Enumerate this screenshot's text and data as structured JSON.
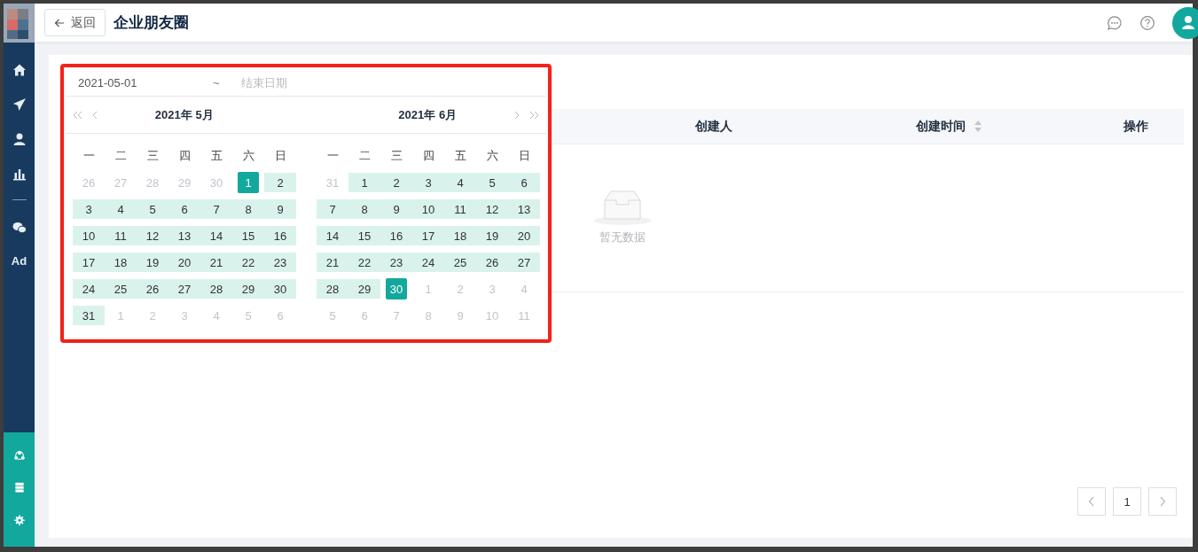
{
  "sidebar": {
    "top_items": [
      {
        "kind": "home"
      },
      {
        "kind": "send"
      },
      {
        "kind": "user"
      },
      {
        "kind": "chart"
      },
      {
        "kind": "divider"
      },
      {
        "kind": "wechat"
      },
      {
        "kind": "text",
        "label": "Ad"
      }
    ],
    "bottom_items": [
      {
        "kind": "network"
      },
      {
        "kind": "server"
      },
      {
        "kind": "settings"
      }
    ]
  },
  "header": {
    "back_button": "返回",
    "title": "企业朋友圈"
  },
  "date_picker": {
    "start_value": "2021-05-01",
    "separator": "~",
    "end_placeholder": "结束日期",
    "panels": [
      {
        "title": "2021年 5月",
        "weekdays": [
          "一",
          "二",
          "三",
          "四",
          "五",
          "六",
          "日"
        ],
        "weeks": [
          [
            {
              "d": "26",
              "kind": "out"
            },
            {
              "d": "27",
              "kind": "out"
            },
            {
              "d": "28",
              "kind": "out"
            },
            {
              "d": "29",
              "kind": "out"
            },
            {
              "d": "30",
              "kind": "out"
            },
            {
              "d": "1",
              "kind": "endpoint"
            },
            {
              "d": "2",
              "kind": "range"
            }
          ],
          [
            {
              "d": "3",
              "kind": "range"
            },
            {
              "d": "4",
              "kind": "range"
            },
            {
              "d": "5",
              "kind": "range"
            },
            {
              "d": "6",
              "kind": "range"
            },
            {
              "d": "7",
              "kind": "range"
            },
            {
              "d": "8",
              "kind": "range"
            },
            {
              "d": "9",
              "kind": "range"
            }
          ],
          [
            {
              "d": "10",
              "kind": "range"
            },
            {
              "d": "11",
              "kind": "range"
            },
            {
              "d": "12",
              "kind": "range"
            },
            {
              "d": "13",
              "kind": "range"
            },
            {
              "d": "14",
              "kind": "range"
            },
            {
              "d": "15",
              "kind": "range"
            },
            {
              "d": "16",
              "kind": "range"
            }
          ],
          [
            {
              "d": "17",
              "kind": "range"
            },
            {
              "d": "18",
              "kind": "range"
            },
            {
              "d": "19",
              "kind": "range"
            },
            {
              "d": "20",
              "kind": "range"
            },
            {
              "d": "21",
              "kind": "range"
            },
            {
              "d": "22",
              "kind": "range"
            },
            {
              "d": "23",
              "kind": "range"
            }
          ],
          [
            {
              "d": "24",
              "kind": "range"
            },
            {
              "d": "25",
              "kind": "range"
            },
            {
              "d": "26",
              "kind": "range"
            },
            {
              "d": "27",
              "kind": "range"
            },
            {
              "d": "28",
              "kind": "range"
            },
            {
              "d": "29",
              "kind": "range"
            },
            {
              "d": "30",
              "kind": "range"
            }
          ],
          [
            {
              "d": "31",
              "kind": "range"
            },
            {
              "d": "1",
              "kind": "out"
            },
            {
              "d": "2",
              "kind": "out"
            },
            {
              "d": "3",
              "kind": "out"
            },
            {
              "d": "4",
              "kind": "out"
            },
            {
              "d": "5",
              "kind": "out"
            },
            {
              "d": "6",
              "kind": "out"
            }
          ]
        ]
      },
      {
        "title": "2021年 6月",
        "weekdays": [
          "一",
          "二",
          "三",
          "四",
          "五",
          "六",
          "日"
        ],
        "weeks": [
          [
            {
              "d": "31",
              "kind": "out"
            },
            {
              "d": "1",
              "kind": "range"
            },
            {
              "d": "2",
              "kind": "range"
            },
            {
              "d": "3",
              "kind": "range"
            },
            {
              "d": "4",
              "kind": "range"
            },
            {
              "d": "5",
              "kind": "range"
            },
            {
              "d": "6",
              "kind": "range"
            }
          ],
          [
            {
              "d": "7",
              "kind": "range"
            },
            {
              "d": "8",
              "kind": "range"
            },
            {
              "d": "9",
              "kind": "range"
            },
            {
              "d": "10",
              "kind": "range"
            },
            {
              "d": "11",
              "kind": "range"
            },
            {
              "d": "12",
              "kind": "range"
            },
            {
              "d": "13",
              "kind": "range"
            }
          ],
          [
            {
              "d": "14",
              "kind": "range"
            },
            {
              "d": "15",
              "kind": "range"
            },
            {
              "d": "16",
              "kind": "range"
            },
            {
              "d": "17",
              "kind": "range"
            },
            {
              "d": "18",
              "kind": "range"
            },
            {
              "d": "19",
              "kind": "range"
            },
            {
              "d": "20",
              "kind": "range"
            }
          ],
          [
            {
              "d": "21",
              "kind": "range"
            },
            {
              "d": "22",
              "kind": "range"
            },
            {
              "d": "23",
              "kind": "range"
            },
            {
              "d": "24",
              "kind": "range"
            },
            {
              "d": "25",
              "kind": "range"
            },
            {
              "d": "26",
              "kind": "range"
            },
            {
              "d": "27",
              "kind": "range"
            }
          ],
          [
            {
              "d": "28",
              "kind": "range"
            },
            {
              "d": "29",
              "kind": "range"
            },
            {
              "d": "30",
              "kind": "endpoint"
            },
            {
              "d": "1",
              "kind": "out"
            },
            {
              "d": "2",
              "kind": "out"
            },
            {
              "d": "3",
              "kind": "out"
            },
            {
              "d": "4",
              "kind": "out"
            }
          ],
          [
            {
              "d": "5",
              "kind": "out"
            },
            {
              "d": "6",
              "kind": "out"
            },
            {
              "d": "7",
              "kind": "out"
            },
            {
              "d": "8",
              "kind": "out"
            },
            {
              "d": "9",
              "kind": "out"
            },
            {
              "d": "10",
              "kind": "out"
            },
            {
              "d": "11",
              "kind": "out"
            }
          ]
        ]
      }
    ]
  },
  "table": {
    "columns": [
      {
        "label": "创建人",
        "sortable": false
      },
      {
        "label": "创建时间",
        "sortable": true
      },
      {
        "label": "操作",
        "sortable": false
      }
    ],
    "empty_text": "暂无数据"
  },
  "pagination": {
    "pages": [
      {
        "label": "1",
        "selected": true
      }
    ]
  }
}
